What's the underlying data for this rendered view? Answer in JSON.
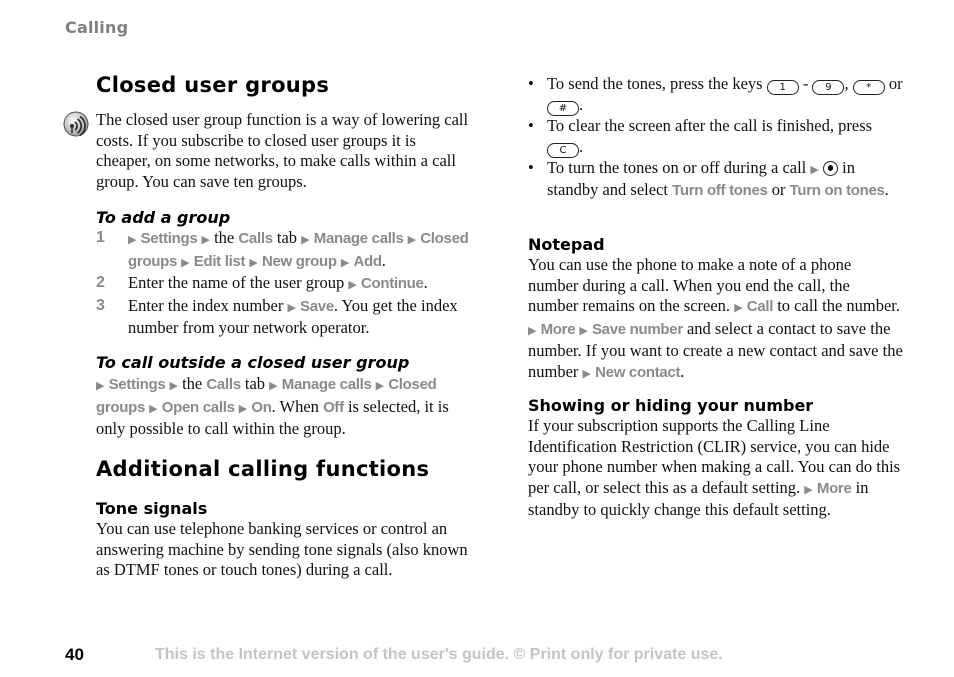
{
  "running_head": "Calling",
  "left": {
    "section1": {
      "title": "Closed user groups",
      "icon": "network-service-icon",
      "intro": "The closed user group function is a way of lowering call costs. If you subscribe to closed user groups it is cheaper, on some networks, to make calls within a call group. You can save ten groups.",
      "add_group": {
        "title": "To add a group",
        "steps": [
          {
            "num": "1",
            "parts": [
              {
                "t": "arrow"
              },
              {
                "t": "ui",
                "v": "Settings"
              },
              {
                "t": "arrow"
              },
              {
                "t": "txt",
                "v": "the"
              },
              {
                "t": "ui",
                "v": "Calls"
              },
              {
                "t": "txt",
                "v": "tab"
              },
              {
                "t": "arrow"
              },
              {
                "t": "ui",
                "v": "Manage calls"
              },
              {
                "t": "arrow"
              },
              {
                "t": "ui",
                "v": "Closed groups"
              },
              {
                "t": "arrow"
              },
              {
                "t": "ui",
                "v": "Edit list"
              },
              {
                "t": "arrow"
              },
              {
                "t": "ui",
                "v": "New group"
              },
              {
                "t": "arrow"
              },
              {
                "t": "ui",
                "v": "Add"
              },
              {
                "t": "punct",
                "v": "."
              }
            ]
          },
          {
            "num": "2",
            "parts": [
              {
                "t": "txt",
                "v": "Enter the name of the user group"
              },
              {
                "t": "arrow"
              },
              {
                "t": "ui",
                "v": "Continue"
              },
              {
                "t": "punct",
                "v": "."
              }
            ]
          },
          {
            "num": "3",
            "parts": [
              {
                "t": "txt",
                "v": "Enter the index number"
              },
              {
                "t": "arrow"
              },
              {
                "t": "ui",
                "v": "Save"
              },
              {
                "t": "punct",
                "v": "."
              },
              {
                "t": "txt",
                "v": "You get the index number from your network operator."
              }
            ]
          }
        ]
      },
      "call_outside": {
        "title": "To call outside a closed user group",
        "parts": [
          {
            "t": "arrow"
          },
          {
            "t": "ui",
            "v": "Settings"
          },
          {
            "t": "arrow"
          },
          {
            "t": "txt",
            "v": "the"
          },
          {
            "t": "ui",
            "v": "Calls"
          },
          {
            "t": "txt",
            "v": "tab"
          },
          {
            "t": "arrow"
          },
          {
            "t": "ui",
            "v": "Manage calls"
          },
          {
            "t": "arrow"
          },
          {
            "t": "ui",
            "v": "Closed groups"
          },
          {
            "t": "arrow"
          },
          {
            "t": "ui",
            "v": "Open calls"
          },
          {
            "t": "arrow"
          },
          {
            "t": "ui",
            "v": "On"
          },
          {
            "t": "punct",
            "v": "."
          },
          {
            "t": "txt",
            "v": "When"
          },
          {
            "t": "ui",
            "v": "Off"
          },
          {
            "t": "txt",
            "v": "is selected, it is only possible to call within the group."
          }
        ]
      }
    },
    "section2": {
      "title": "Additional calling functions",
      "tone_signals": {
        "title": "Tone signals",
        "body": "You can use telephone banking services or control an answering machine by sending tone signals (also known as DTMF tones or touch tones) during a call."
      }
    }
  },
  "right": {
    "bullets": [
      {
        "parts": [
          {
            "t": "txt",
            "v": "To send the tones, press the keys"
          },
          {
            "t": "key",
            "v": "1"
          },
          {
            "t": "txt",
            "v": "-"
          },
          {
            "t": "key",
            "v": "9"
          },
          {
            "t": "punct",
            "v": ","
          },
          {
            "t": "key",
            "v": "*"
          },
          {
            "t": "txt",
            "v": "or"
          },
          {
            "t": "key",
            "v": "#"
          },
          {
            "t": "punct",
            "v": "."
          }
        ]
      },
      {
        "parts": [
          {
            "t": "txt",
            "v": "To clear the screen after the call is finished, press"
          },
          {
            "t": "key",
            "v": "C"
          },
          {
            "t": "punct",
            "v": "."
          }
        ]
      },
      {
        "parts": [
          {
            "t": "txt",
            "v": "To turn the tones on or off during a call"
          },
          {
            "t": "arrow"
          },
          {
            "t": "navkey"
          },
          {
            "t": "txt",
            "v": "in standby and select"
          },
          {
            "t": "ui",
            "v": "Turn off tones"
          },
          {
            "t": "txt",
            "v": "or"
          },
          {
            "t": "ui",
            "v": "Turn on tones"
          },
          {
            "t": "punct",
            "v": "."
          }
        ]
      }
    ],
    "notepad": {
      "title": "Notepad",
      "parts": [
        {
          "t": "txt",
          "v": "You can use the phone to make a note of a phone number during a call. When you end the call, the number remains on the screen."
        },
        {
          "t": "arrow"
        },
        {
          "t": "ui",
          "v": "Call"
        },
        {
          "t": "txt",
          "v": "to call the number."
        },
        {
          "t": "arrow"
        },
        {
          "t": "ui",
          "v": "More"
        },
        {
          "t": "arrow"
        },
        {
          "t": "ui",
          "v": "Save number"
        },
        {
          "t": "txt",
          "v": "and select a contact to save the number. If you want to create a new contact and save the number"
        },
        {
          "t": "arrow"
        },
        {
          "t": "ui",
          "v": "New contact"
        },
        {
          "t": "punct",
          "v": "."
        }
      ]
    },
    "show_hide": {
      "title": "Showing or hiding your number",
      "parts": [
        {
          "t": "txt",
          "v": "If your subscription supports the Calling Line Identification Restriction (CLIR) service, you can hide your phone number when making a call. You can do this per call, or select this as a default setting."
        },
        {
          "t": "arrow"
        },
        {
          "t": "ui",
          "v": "More"
        },
        {
          "t": "txt",
          "v": "in standby to quickly change this default setting."
        }
      ]
    }
  },
  "footer": {
    "page_number": "40",
    "notice": "This is the Internet version of the user's guide. © Print only for private use."
  },
  "colors": {
    "ui_text": "#8a8a8a",
    "running_head": "#7f7f7f",
    "footer_notice": "#c4c4c4"
  }
}
